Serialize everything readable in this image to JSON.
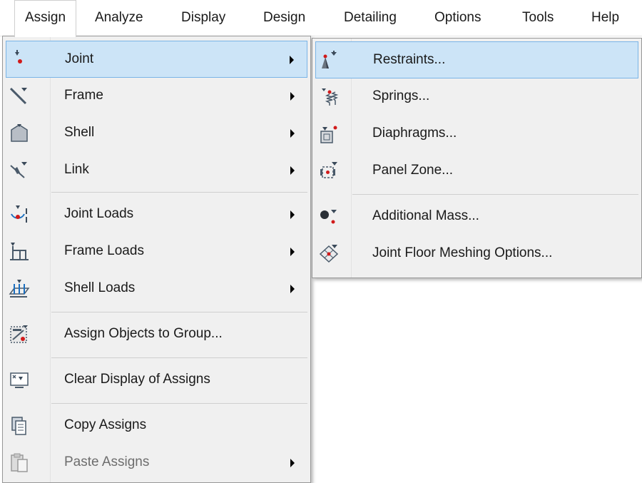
{
  "menubar": {
    "items": [
      "Assign",
      "Analyze",
      "Display",
      "Design",
      "Detailing",
      "Options",
      "Tools",
      "Help"
    ]
  },
  "assign_menu": {
    "items": [
      {
        "label": "Joint",
        "icon": "joint-icon",
        "has_submenu": true,
        "highlighted": true
      },
      {
        "label": "Frame",
        "icon": "frame-icon",
        "has_submenu": true
      },
      {
        "label": "Shell",
        "icon": "shell-icon",
        "has_submenu": true
      },
      {
        "label": "Link",
        "icon": "link-icon",
        "has_submenu": true
      },
      {
        "label": "Joint Loads",
        "icon": "joint-loads-icon",
        "has_submenu": true
      },
      {
        "label": "Frame Loads",
        "icon": "frame-loads-icon",
        "has_submenu": true
      },
      {
        "label": "Shell Loads",
        "icon": "shell-loads-icon",
        "has_submenu": true
      },
      {
        "label": "Assign Objects to Group...",
        "icon": "assign-group-icon"
      },
      {
        "label": "Clear Display of Assigns",
        "icon": "clear-display-icon"
      },
      {
        "label": "Copy Assigns",
        "icon": "copy-assigns-icon"
      },
      {
        "label": "Paste Assigns",
        "icon": "paste-assigns-icon",
        "has_submenu": true,
        "disabled": true
      }
    ]
  },
  "joint_submenu": {
    "items": [
      {
        "label": "Restraints...",
        "icon": "restraints-icon",
        "highlighted": true
      },
      {
        "label": "Springs...",
        "icon": "springs-icon"
      },
      {
        "label": "Diaphragms...",
        "icon": "diaphragms-icon"
      },
      {
        "label": "Panel Zone...",
        "icon": "panel-zone-icon"
      },
      {
        "label": "Additional Mass...",
        "icon": "additional-mass-icon"
      },
      {
        "label": "Joint Floor Meshing Options...",
        "icon": "floor-meshing-icon"
      }
    ]
  },
  "colors": {
    "highlight_fill": "#cce4f7",
    "highlight_border": "#7ab4e6",
    "menu_bg": "#f0f0f0",
    "icon_red": "#d11a1a",
    "icon_blue": "#1b6fc0"
  }
}
